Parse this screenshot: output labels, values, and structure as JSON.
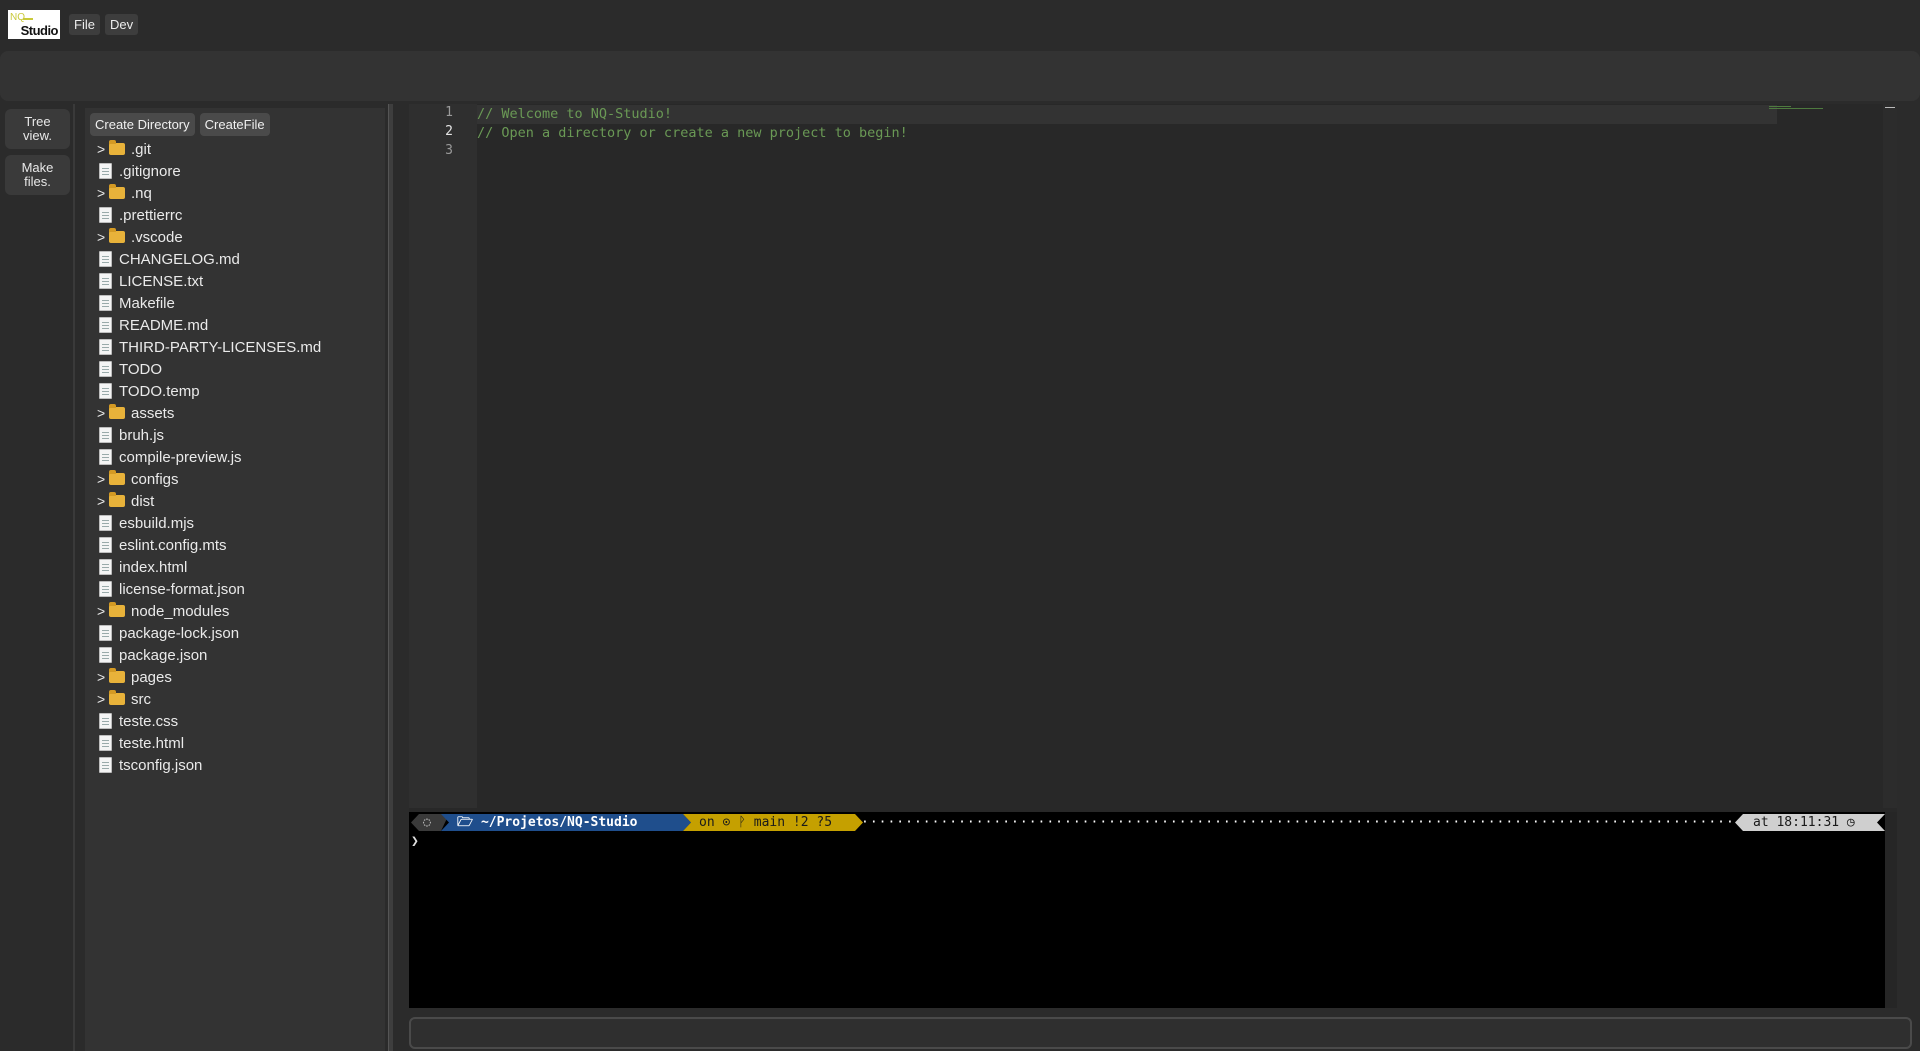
{
  "menubar": {
    "logo_top": "NQ",
    "logo_bottom": "Studio",
    "file_label": "File",
    "dev_label": "Dev"
  },
  "activity": {
    "tree_view_line1": "Tree",
    "tree_view_line2": "view.",
    "make_files_line1": "Make",
    "make_files_line2": "files."
  },
  "sidebar": {
    "create_directory_label": "Create Directory",
    "create_file_label": "CreateFile",
    "items": [
      {
        "name": ".git",
        "type": "folder"
      },
      {
        "name": ".gitignore",
        "type": "file"
      },
      {
        "name": ".nq",
        "type": "folder"
      },
      {
        "name": ".prettierrc",
        "type": "file"
      },
      {
        "name": ".vscode",
        "type": "folder"
      },
      {
        "name": "CHANGELOG.md",
        "type": "file"
      },
      {
        "name": "LICENSE.txt",
        "type": "file"
      },
      {
        "name": "Makefile",
        "type": "file"
      },
      {
        "name": "README.md",
        "type": "file"
      },
      {
        "name": "THIRD-PARTY-LICENSES.md",
        "type": "file"
      },
      {
        "name": "TODO",
        "type": "file"
      },
      {
        "name": "TODO.temp",
        "type": "file"
      },
      {
        "name": "assets",
        "type": "folder"
      },
      {
        "name": "bruh.js",
        "type": "file"
      },
      {
        "name": "compile-preview.js",
        "type": "file"
      },
      {
        "name": "configs",
        "type": "folder"
      },
      {
        "name": "dist",
        "type": "folder"
      },
      {
        "name": "esbuild.mjs",
        "type": "file"
      },
      {
        "name": "eslint.config.mts",
        "type": "file"
      },
      {
        "name": "index.html",
        "type": "file"
      },
      {
        "name": "license-format.json",
        "type": "file"
      },
      {
        "name": "node_modules",
        "type": "folder"
      },
      {
        "name": "package-lock.json",
        "type": "file"
      },
      {
        "name": "package.json",
        "type": "file"
      },
      {
        "name": "pages",
        "type": "folder"
      },
      {
        "name": "src",
        "type": "folder"
      },
      {
        "name": "teste.css",
        "type": "file"
      },
      {
        "name": "teste.html",
        "type": "file"
      },
      {
        "name": "tsconfig.json",
        "type": "file"
      }
    ]
  },
  "editor": {
    "line_numbers": [
      "1",
      "2",
      "3"
    ],
    "active_line": "2",
    "lines": [
      "// Welcome to NQ-Studio!",
      "// Open a directory or create a new project to begin!",
      ""
    ]
  },
  "terminal": {
    "path": "~/Projetos/NQ-Studio",
    "git_info": "on ⊙ ᚹ main !2 ?5",
    "time": "at 18:11:31 ◷",
    "dots": "········································································································",
    "cursor": "❯"
  },
  "bottom_input": {
    "value": ""
  }
}
